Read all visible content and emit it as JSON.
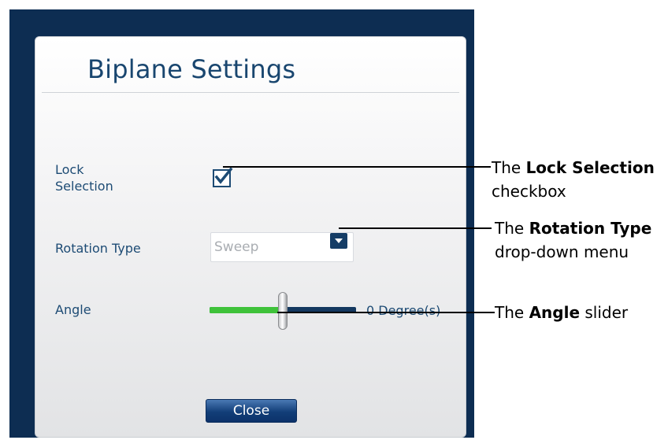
{
  "dialog": {
    "title": "Biplane Settings",
    "lock_selection": {
      "label_line1": "Lock",
      "label_line2": "Selection",
      "checked": true
    },
    "rotation_type": {
      "label": "Rotation Type",
      "value": "Sweep"
    },
    "angle": {
      "label": "Angle",
      "value_text": "0 Degree(s)",
      "slider_fraction": 0.5
    },
    "close_label": "Close"
  },
  "callouts": {
    "lock": {
      "pre": "The ",
      "bold": "Lock Selection",
      "post": "checkbox"
    },
    "rotation": {
      "pre": "The ",
      "bold": "Rotation Type",
      "post": "drop-down menu"
    },
    "angle": {
      "pre": "The ",
      "bold": "Angle",
      "post": " slider"
    }
  },
  "colors": {
    "frame": "#0d2d52",
    "accent_blue": "#19466f",
    "slider_fill": "#3fc23a",
    "slider_track": "#14385f"
  }
}
